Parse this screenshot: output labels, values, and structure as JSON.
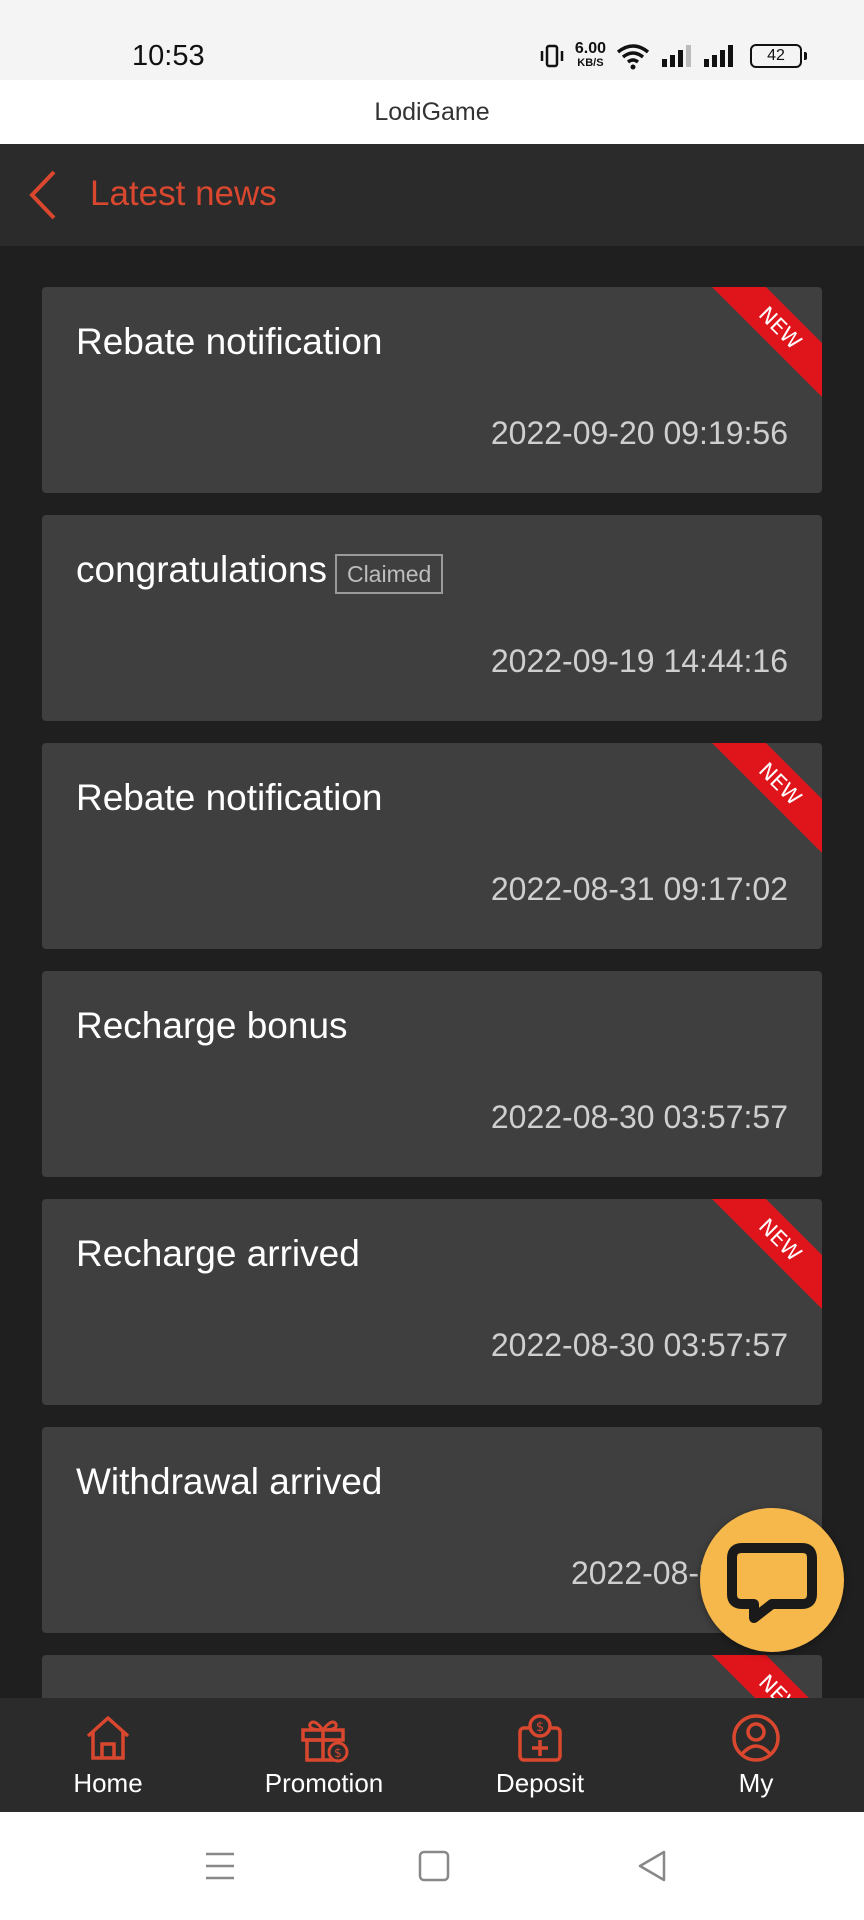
{
  "status_bar": {
    "time": "10:53",
    "net_speed_value": "6.00",
    "net_speed_unit": "KB/S",
    "battery": "42"
  },
  "app_title": "LodiGame",
  "header": {
    "title": "Latest news"
  },
  "news": [
    {
      "title": "Rebate notification",
      "time": "2022-09-20 09:19:56",
      "is_new": true,
      "badge": ""
    },
    {
      "title": "congratulations",
      "time": "2022-09-19 14:44:16",
      "is_new": false,
      "badge": "Claimed"
    },
    {
      "title": "Rebate notification",
      "time": "2022-08-31 09:17:02",
      "is_new": true,
      "badge": ""
    },
    {
      "title": "Recharge bonus",
      "time": "2022-08-30 03:57:57",
      "is_new": false,
      "badge": ""
    },
    {
      "title": "Recharge arrived",
      "time": "2022-08-30 03:57:57",
      "is_new": true,
      "badge": ""
    },
    {
      "title": "Withdrawal arrived",
      "time": "2022-08-29 16:",
      "is_new": false,
      "badge": ""
    },
    {
      "title": "",
      "time": "",
      "is_new": true,
      "badge": ""
    }
  ],
  "new_label": "NEW",
  "nav": [
    {
      "label": "Home",
      "icon": "home-icon"
    },
    {
      "label": "Promotion",
      "icon": "gift-icon"
    },
    {
      "label": "Deposit",
      "icon": "deposit-icon"
    },
    {
      "label": "My",
      "icon": "user-icon"
    }
  ],
  "colors": {
    "accent": "#d9472f",
    "ribbon": "#e0151c",
    "card": "#3f3f3f",
    "background": "#1f1f1f",
    "chat_button": "#f7b84b"
  }
}
